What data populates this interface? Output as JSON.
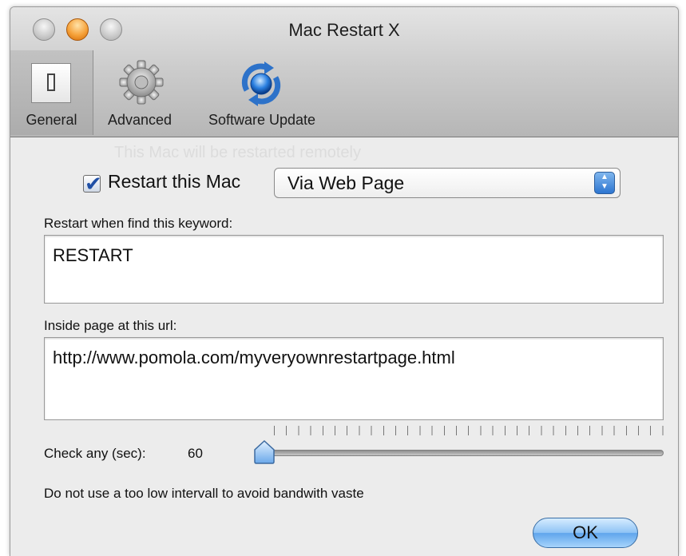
{
  "window": {
    "title": "Mac Restart X"
  },
  "toolbar": {
    "items": [
      {
        "label": "General",
        "icon": "switch-icon",
        "selected": true
      },
      {
        "label": "Advanced",
        "icon": "gear-icon",
        "selected": false
      },
      {
        "label": "Software Update",
        "icon": "sync-icon",
        "selected": false
      }
    ]
  },
  "general": {
    "ghost_text": "This Mac will be restarted remotely",
    "restart_checkbox": {
      "label": "Restart this Mac",
      "checked": true
    },
    "method_popup": {
      "selected": "Via Web Page"
    },
    "keyword_label": "Restart when find this keyword:",
    "keyword_value": "RESTART",
    "url_label": "Inside page at this url:",
    "url_value": "http://www.pomola.com/myveryownrestartpage.html",
    "interval_label": "Check any (sec):",
    "interval_value": "60",
    "warning": "Do not use a too low intervall to avoid bandwith vaste",
    "ok_label": "OK"
  },
  "colors": {
    "accent": "#5fa5ec",
    "check_blue": "#1f4fa6",
    "window_bg": "#ececec"
  }
}
